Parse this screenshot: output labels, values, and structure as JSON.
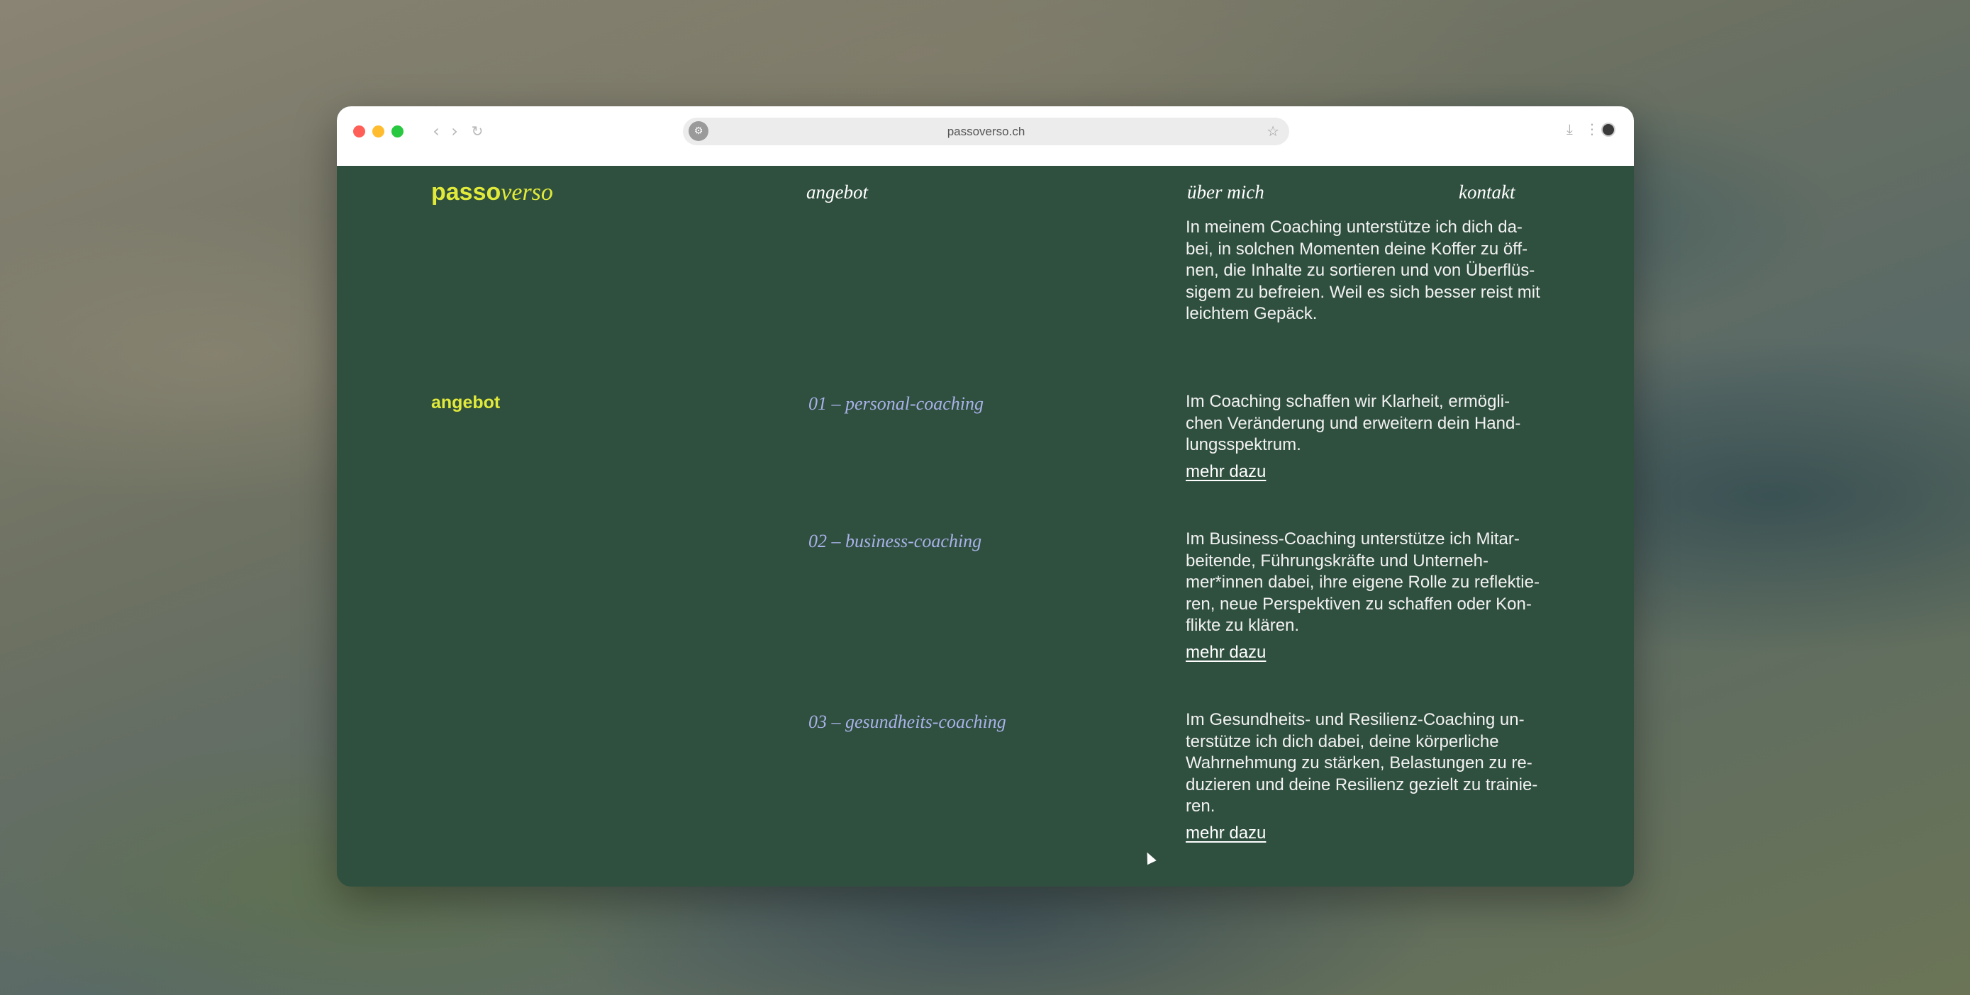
{
  "browser": {
    "url": "passoverso.ch",
    "back_glyph": "‹",
    "forward_glyph": "›",
    "reload_glyph": "↻",
    "site_info_glyph": "⚙",
    "star_glyph": "☆",
    "download_glyph": "⤓",
    "menu_glyph": "⋮"
  },
  "site": {
    "logo_bold": "passo",
    "logo_italic": "verso",
    "nav": {
      "angebot": "angebot",
      "ueber_mich": "über mich",
      "kontakt": "kontakt"
    },
    "intro_text": "In meinem Coaching unterstütze ich dich da-\nbei, in solchen Momenten deine Koffer zu öff-\nnen, die Inhalte zu sortieren und von Überflüs-\nsigem zu befreien. Weil es sich besser reist mit\nleichtem Gepäck.",
    "section_label": "angebot",
    "services": [
      {
        "title": "01 – personal-coaching",
        "text": "Im Coaching schaffen wir Klarheit, ermögli-\nchen Veränderung und erweitern dein Hand-\nlungsspektrum.",
        "link": "mehr dazu"
      },
      {
        "title": "02 – business-coaching",
        "text": "Im Business-Coaching unterstütze ich Mitar-\nbeitende, Führungskräfte und Unterneh-\nmer*innen dabei, ihre eigene Rolle zu reflektie-\nren, neue Perspektiven zu schaffen oder Kon-\nflikte zu klären.",
        "link": "mehr dazu"
      },
      {
        "title": "03 – gesundheits-coaching",
        "text": "Im Gesundheits- und Resilienz-Coaching un-\nterstütze ich dich dabei, deine körperliche\nWahrnehmung zu stärken, Belastungen zu re-\nduzieren und deine Resilienz gezielt zu trainie-\nren.",
        "link": "mehr dazu"
      }
    ]
  },
  "colors": {
    "page_bg": "#2f4f3f",
    "accent_yellow": "#e1ea3a",
    "service_title": "#a9b2e8"
  }
}
